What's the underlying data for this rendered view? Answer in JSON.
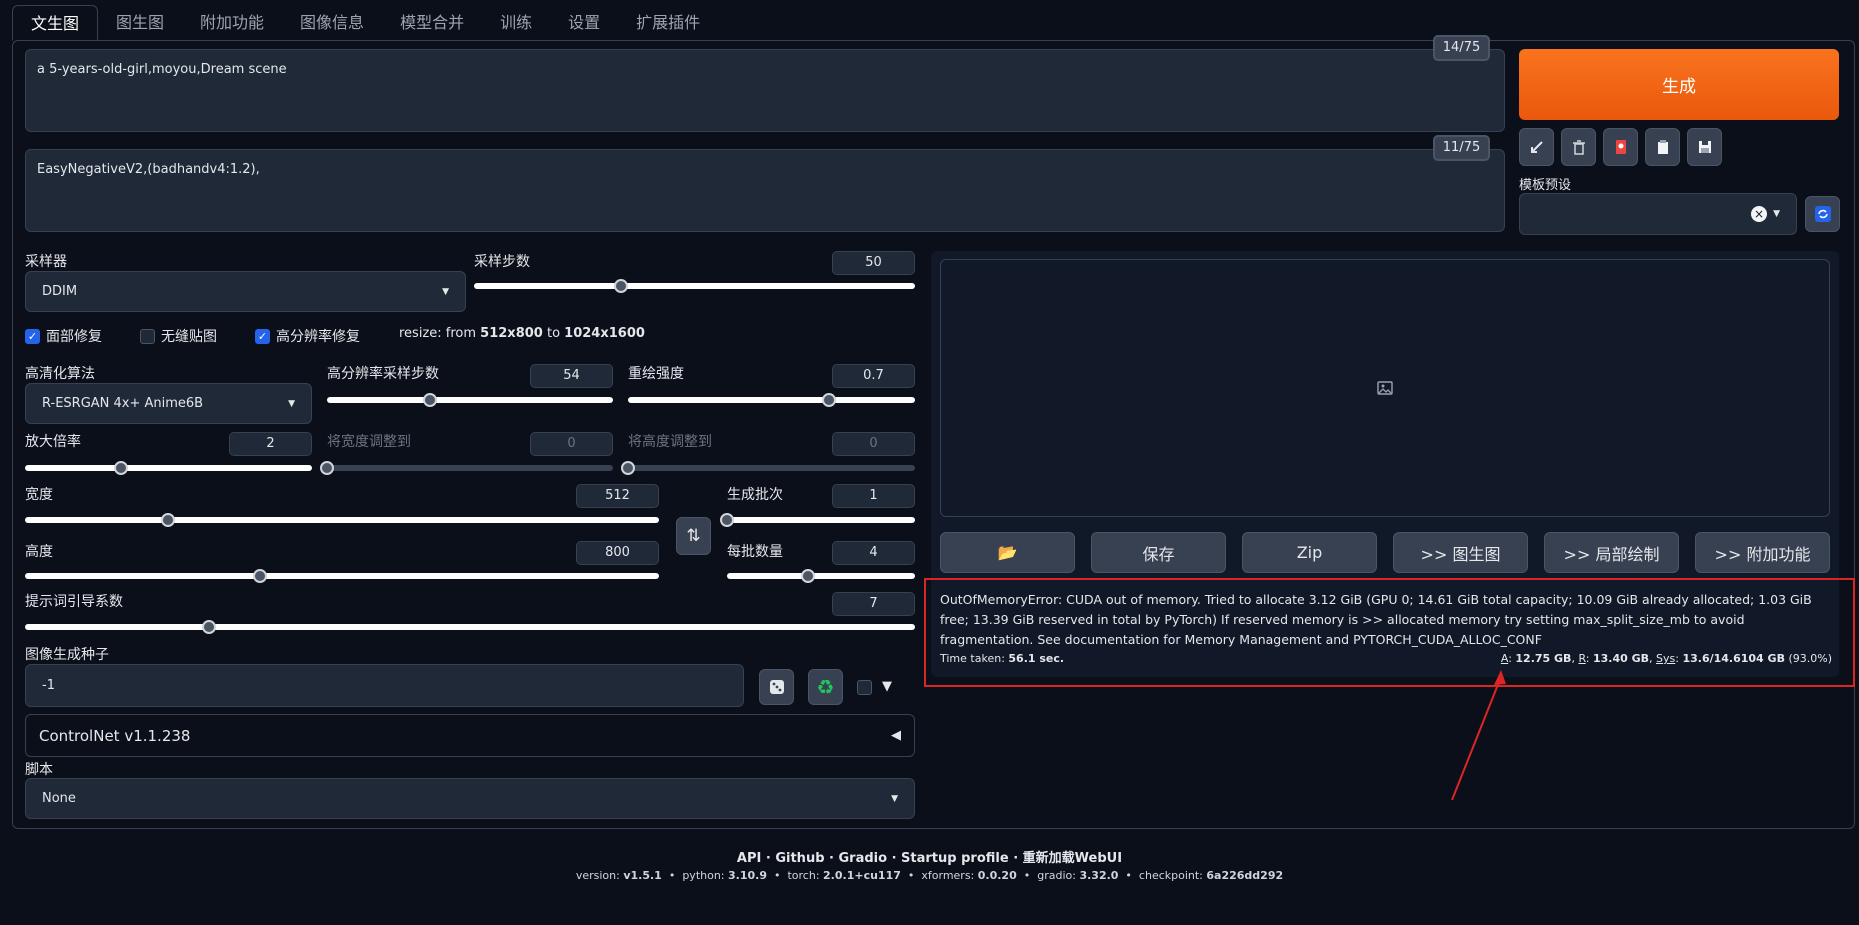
{
  "tabs": [
    "文生图",
    "图生图",
    "附加功能",
    "图像信息",
    "模型合并",
    "训练",
    "设置",
    "扩展插件"
  ],
  "prompt": {
    "positive": "a 5-years-old-girl,moyou,Dream scene",
    "positive_tokens": "14/75",
    "negative": "EasyNegativeV2,(badhandv4:1.2),",
    "negative_tokens": "11/75"
  },
  "generate_label": "生成",
  "toolbar_icons": [
    "arrow-icon",
    "trash-icon",
    "card-icon",
    "clipboard-icon",
    "save-icon"
  ],
  "style_preset": {
    "label": "模板预设",
    "value": "",
    "clear": "×"
  },
  "sampler": {
    "label": "采样器",
    "value": "DDIM",
    "steps_label": "采样步数",
    "steps": 50,
    "steps_max": 150
  },
  "checks": {
    "face": "面部修复",
    "tiling": "无缝贴图",
    "hires": "高分辨率修复",
    "face_on": true,
    "tiling_on": false,
    "hires_on": true
  },
  "resize_note": {
    "prefix": "resize: from ",
    "from": "512x800",
    "mid": " to ",
    "to": "1024x1600"
  },
  "hires": {
    "upscaler_label": "高清化算法",
    "upscaler": "R-ESRGAN 4x+ Anime6B",
    "steps_label": "高分辨率采样步数",
    "steps": 54,
    "steps_max": 150,
    "denoise_label": "重绘强度",
    "denoise": 0.7,
    "denoise_max": 1,
    "scale_label": "放大倍率",
    "scale": 2,
    "scale_min": 1,
    "scale_max": 4,
    "resize_w_label": "将宽度调整到",
    "resize_w": 0,
    "resize_h_label": "将高度调整到",
    "resize_h": 0
  },
  "size": {
    "width_label": "宽度",
    "width": 512,
    "height_label": "高度",
    "height": 800,
    "min": 64,
    "max": 2048,
    "swap_icon": "⇅"
  },
  "batch": {
    "count_label": "生成批次",
    "count": 1,
    "count_min": 1,
    "count_max": 100,
    "size_label": "每批数量",
    "size": 4,
    "size_min": 1,
    "size_max": 8
  },
  "cfg": {
    "label": "提示词引导系数",
    "value": 7,
    "min": 1,
    "max": 30
  },
  "seed": {
    "label": "图像生成种子",
    "value": "-1"
  },
  "controlnet": {
    "label": "ControlNet v1.1.238",
    "arrow": "◀"
  },
  "script": {
    "label": "脚本",
    "value": "None"
  },
  "output_buttons": [
    "📂",
    "保存",
    "Zip",
    ">> 图生图",
    ">> 局部绘制",
    ">> 附加功能"
  ],
  "error": {
    "message": "OutOfMemoryError: CUDA out of memory. Tried to allocate 3.12 GiB (GPU 0; 14.61 GiB total capacity; 10.09 GiB already allocated; 1.03 GiB free; 13.39 GiB reserved in total by PyTorch) If reserved memory is >> allocated memory try setting max_split_size_mb to avoid fragmentation. See documentation for Memory Management and PYTORCH_CUDA_ALLOC_CONF",
    "time_label": "Time taken: ",
    "time_value": "56.1 sec.",
    "a_label": "A",
    "a_value": "12.75 GB",
    "r_label": "R",
    "r_value": "13.40 GB",
    "sys_label": "Sys",
    "sys_value": "13.6/14.6104 GB",
    "percent": "(93.0%)"
  },
  "footer": {
    "links": [
      "API",
      "Github",
      "Gradio",
      "Startup profile",
      "重新加载WebUI"
    ],
    "versions": [
      [
        "version: ",
        "v1.5.1"
      ],
      [
        "python: ",
        "3.10.9"
      ],
      [
        "torch: ",
        "2.0.1+cu117"
      ],
      [
        "xformers: ",
        "0.0.20"
      ],
      [
        "gradio: ",
        "3.32.0"
      ],
      [
        "checkpoint: ",
        "6a226dd292"
      ]
    ]
  },
  "colors": {
    "accent": "#ea580c",
    "highlight": "#dc2626",
    "check": "#2563eb"
  }
}
